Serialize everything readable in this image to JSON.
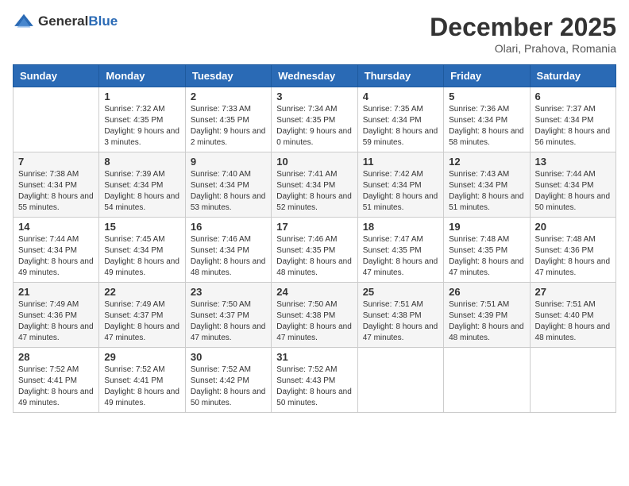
{
  "header": {
    "logo_general": "General",
    "logo_blue": "Blue",
    "month": "December 2025",
    "location": "Olari, Prahova, Romania"
  },
  "days_of_week": [
    "Sunday",
    "Monday",
    "Tuesday",
    "Wednesday",
    "Thursday",
    "Friday",
    "Saturday"
  ],
  "weeks": [
    [
      {
        "day": "",
        "sunrise": "",
        "sunset": "",
        "daylight": ""
      },
      {
        "day": "1",
        "sunrise": "Sunrise: 7:32 AM",
        "sunset": "Sunset: 4:35 PM",
        "daylight": "Daylight: 9 hours and 3 minutes."
      },
      {
        "day": "2",
        "sunrise": "Sunrise: 7:33 AM",
        "sunset": "Sunset: 4:35 PM",
        "daylight": "Daylight: 9 hours and 2 minutes."
      },
      {
        "day": "3",
        "sunrise": "Sunrise: 7:34 AM",
        "sunset": "Sunset: 4:35 PM",
        "daylight": "Daylight: 9 hours and 0 minutes."
      },
      {
        "day": "4",
        "sunrise": "Sunrise: 7:35 AM",
        "sunset": "Sunset: 4:34 PM",
        "daylight": "Daylight: 8 hours and 59 minutes."
      },
      {
        "day": "5",
        "sunrise": "Sunrise: 7:36 AM",
        "sunset": "Sunset: 4:34 PM",
        "daylight": "Daylight: 8 hours and 58 minutes."
      },
      {
        "day": "6",
        "sunrise": "Sunrise: 7:37 AM",
        "sunset": "Sunset: 4:34 PM",
        "daylight": "Daylight: 8 hours and 56 minutes."
      }
    ],
    [
      {
        "day": "7",
        "sunrise": "Sunrise: 7:38 AM",
        "sunset": "Sunset: 4:34 PM",
        "daylight": "Daylight: 8 hours and 55 minutes."
      },
      {
        "day": "8",
        "sunrise": "Sunrise: 7:39 AM",
        "sunset": "Sunset: 4:34 PM",
        "daylight": "Daylight: 8 hours and 54 minutes."
      },
      {
        "day": "9",
        "sunrise": "Sunrise: 7:40 AM",
        "sunset": "Sunset: 4:34 PM",
        "daylight": "Daylight: 8 hours and 53 minutes."
      },
      {
        "day": "10",
        "sunrise": "Sunrise: 7:41 AM",
        "sunset": "Sunset: 4:34 PM",
        "daylight": "Daylight: 8 hours and 52 minutes."
      },
      {
        "day": "11",
        "sunrise": "Sunrise: 7:42 AM",
        "sunset": "Sunset: 4:34 PM",
        "daylight": "Daylight: 8 hours and 51 minutes."
      },
      {
        "day": "12",
        "sunrise": "Sunrise: 7:43 AM",
        "sunset": "Sunset: 4:34 PM",
        "daylight": "Daylight: 8 hours and 51 minutes."
      },
      {
        "day": "13",
        "sunrise": "Sunrise: 7:44 AM",
        "sunset": "Sunset: 4:34 PM",
        "daylight": "Daylight: 8 hours and 50 minutes."
      }
    ],
    [
      {
        "day": "14",
        "sunrise": "Sunrise: 7:44 AM",
        "sunset": "Sunset: 4:34 PM",
        "daylight": "Daylight: 8 hours and 49 minutes."
      },
      {
        "day": "15",
        "sunrise": "Sunrise: 7:45 AM",
        "sunset": "Sunset: 4:34 PM",
        "daylight": "Daylight: 8 hours and 49 minutes."
      },
      {
        "day": "16",
        "sunrise": "Sunrise: 7:46 AM",
        "sunset": "Sunset: 4:34 PM",
        "daylight": "Daylight: 8 hours and 48 minutes."
      },
      {
        "day": "17",
        "sunrise": "Sunrise: 7:46 AM",
        "sunset": "Sunset: 4:35 PM",
        "daylight": "Daylight: 8 hours and 48 minutes."
      },
      {
        "day": "18",
        "sunrise": "Sunrise: 7:47 AM",
        "sunset": "Sunset: 4:35 PM",
        "daylight": "Daylight: 8 hours and 47 minutes."
      },
      {
        "day": "19",
        "sunrise": "Sunrise: 7:48 AM",
        "sunset": "Sunset: 4:35 PM",
        "daylight": "Daylight: 8 hours and 47 minutes."
      },
      {
        "day": "20",
        "sunrise": "Sunrise: 7:48 AM",
        "sunset": "Sunset: 4:36 PM",
        "daylight": "Daylight: 8 hours and 47 minutes."
      }
    ],
    [
      {
        "day": "21",
        "sunrise": "Sunrise: 7:49 AM",
        "sunset": "Sunset: 4:36 PM",
        "daylight": "Daylight: 8 hours and 47 minutes."
      },
      {
        "day": "22",
        "sunrise": "Sunrise: 7:49 AM",
        "sunset": "Sunset: 4:37 PM",
        "daylight": "Daylight: 8 hours and 47 minutes."
      },
      {
        "day": "23",
        "sunrise": "Sunrise: 7:50 AM",
        "sunset": "Sunset: 4:37 PM",
        "daylight": "Daylight: 8 hours and 47 minutes."
      },
      {
        "day": "24",
        "sunrise": "Sunrise: 7:50 AM",
        "sunset": "Sunset: 4:38 PM",
        "daylight": "Daylight: 8 hours and 47 minutes."
      },
      {
        "day": "25",
        "sunrise": "Sunrise: 7:51 AM",
        "sunset": "Sunset: 4:38 PM",
        "daylight": "Daylight: 8 hours and 47 minutes."
      },
      {
        "day": "26",
        "sunrise": "Sunrise: 7:51 AM",
        "sunset": "Sunset: 4:39 PM",
        "daylight": "Daylight: 8 hours and 48 minutes."
      },
      {
        "day": "27",
        "sunrise": "Sunrise: 7:51 AM",
        "sunset": "Sunset: 4:40 PM",
        "daylight": "Daylight: 8 hours and 48 minutes."
      }
    ],
    [
      {
        "day": "28",
        "sunrise": "Sunrise: 7:52 AM",
        "sunset": "Sunset: 4:41 PM",
        "daylight": "Daylight: 8 hours and 49 minutes."
      },
      {
        "day": "29",
        "sunrise": "Sunrise: 7:52 AM",
        "sunset": "Sunset: 4:41 PM",
        "daylight": "Daylight: 8 hours and 49 minutes."
      },
      {
        "day": "30",
        "sunrise": "Sunrise: 7:52 AM",
        "sunset": "Sunset: 4:42 PM",
        "daylight": "Daylight: 8 hours and 50 minutes."
      },
      {
        "day": "31",
        "sunrise": "Sunrise: 7:52 AM",
        "sunset": "Sunset: 4:43 PM",
        "daylight": "Daylight: 8 hours and 50 minutes."
      },
      {
        "day": "",
        "sunrise": "",
        "sunset": "",
        "daylight": ""
      },
      {
        "day": "",
        "sunrise": "",
        "sunset": "",
        "daylight": ""
      },
      {
        "day": "",
        "sunrise": "",
        "sunset": "",
        "daylight": ""
      }
    ]
  ]
}
